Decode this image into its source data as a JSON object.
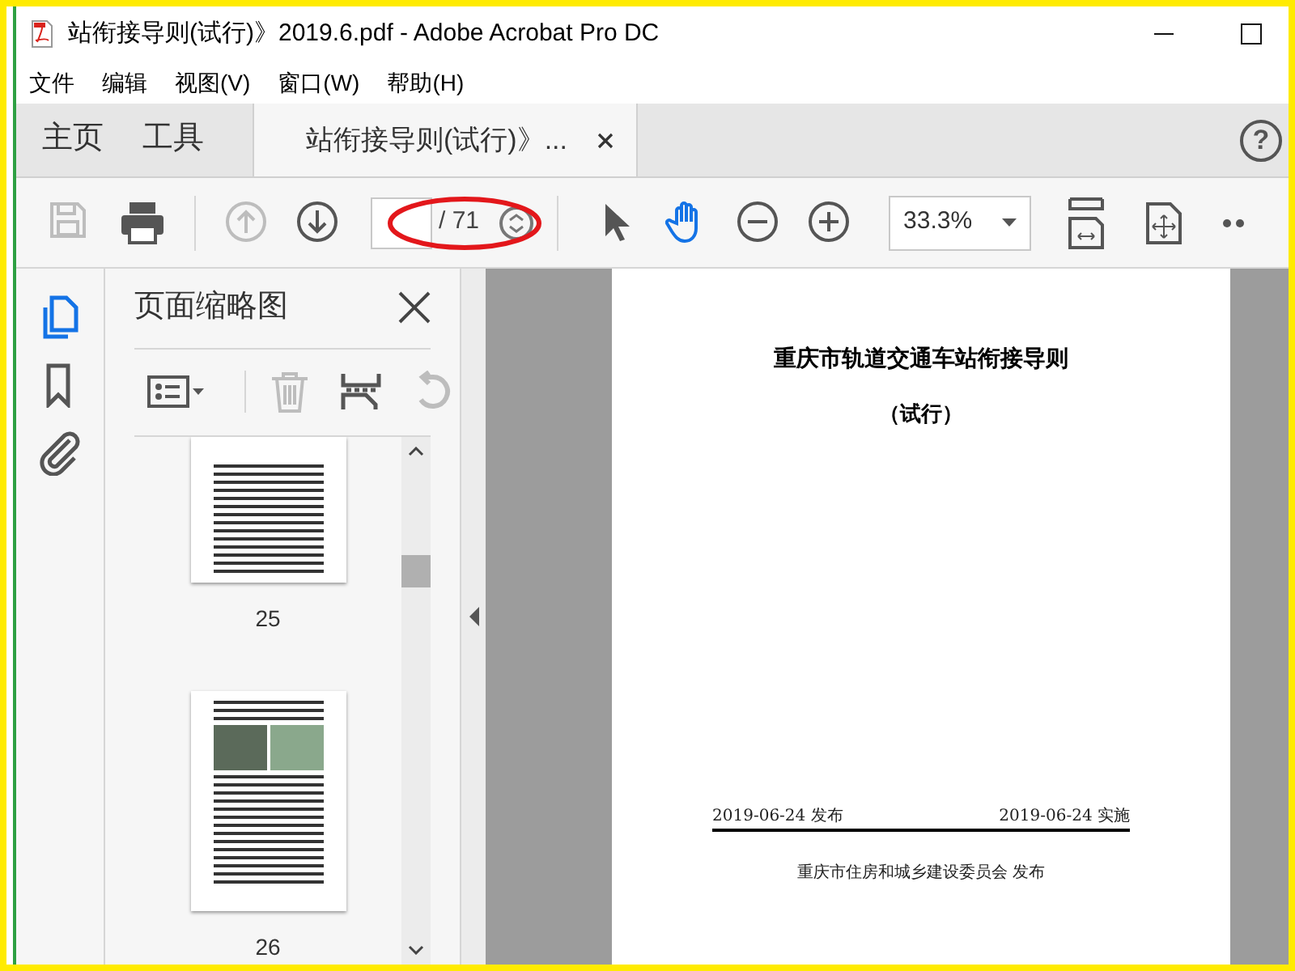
{
  "window": {
    "title": "站衔接导则(试行)》2019.6.pdf - Adobe Acrobat Pro DC"
  },
  "menu": [
    "文件",
    "编辑",
    "视图(V)",
    "窗口(W)",
    "帮助(H)"
  ],
  "tabs": [
    {
      "label": "主页",
      "kind": "nav",
      "selected": false
    },
    {
      "label": "工具",
      "kind": "nav",
      "selected": false
    },
    {
      "label": "站衔接导则(试行)》...",
      "kind": "document",
      "selected": true
    }
  ],
  "help": "?",
  "toolbar": {
    "buttons": [
      {
        "kind": "save",
        "disabled": true
      },
      {
        "kind": "print",
        "disabled": false
      },
      {
        "kind": "page-up",
        "disabled": true
      },
      {
        "kind": "page-down",
        "disabled": false
      }
    ],
    "page_total": "/ 71",
    "tools": [
      {
        "kind": "select",
        "selected": false
      },
      {
        "kind": "hand",
        "selected": true
      },
      {
        "kind": "zoom-out",
        "selected": false
      },
      {
        "kind": "zoom-in",
        "selected": false
      }
    ],
    "zoom": "33.3%"
  },
  "side_icons": [
    {
      "kind": "pages",
      "selected": true
    },
    {
      "kind": "bookmark",
      "selected": false
    },
    {
      "kind": "attachment",
      "selected": false
    }
  ],
  "panel": {
    "title": "页面缩略图",
    "tools": [
      {
        "kind": "options",
        "disabled": false
      },
      {
        "kind": "delete",
        "disabled": true
      },
      {
        "kind": "insert",
        "disabled": false
      },
      {
        "kind": "undo",
        "disabled": true
      }
    ],
    "thumbnails": [
      {
        "label": "25",
        "kind": "text"
      },
      {
        "label": "26",
        "kind": "photos"
      }
    ]
  },
  "document": {
    "title": "重庆市轨道交通车站衔接导则",
    "subtitle": "（试行）",
    "issue_date": "2019-06-24 发布",
    "effective_date": "2019-06-24 实施",
    "publisher": "重庆市住房和城乡建设委员会 发布"
  }
}
